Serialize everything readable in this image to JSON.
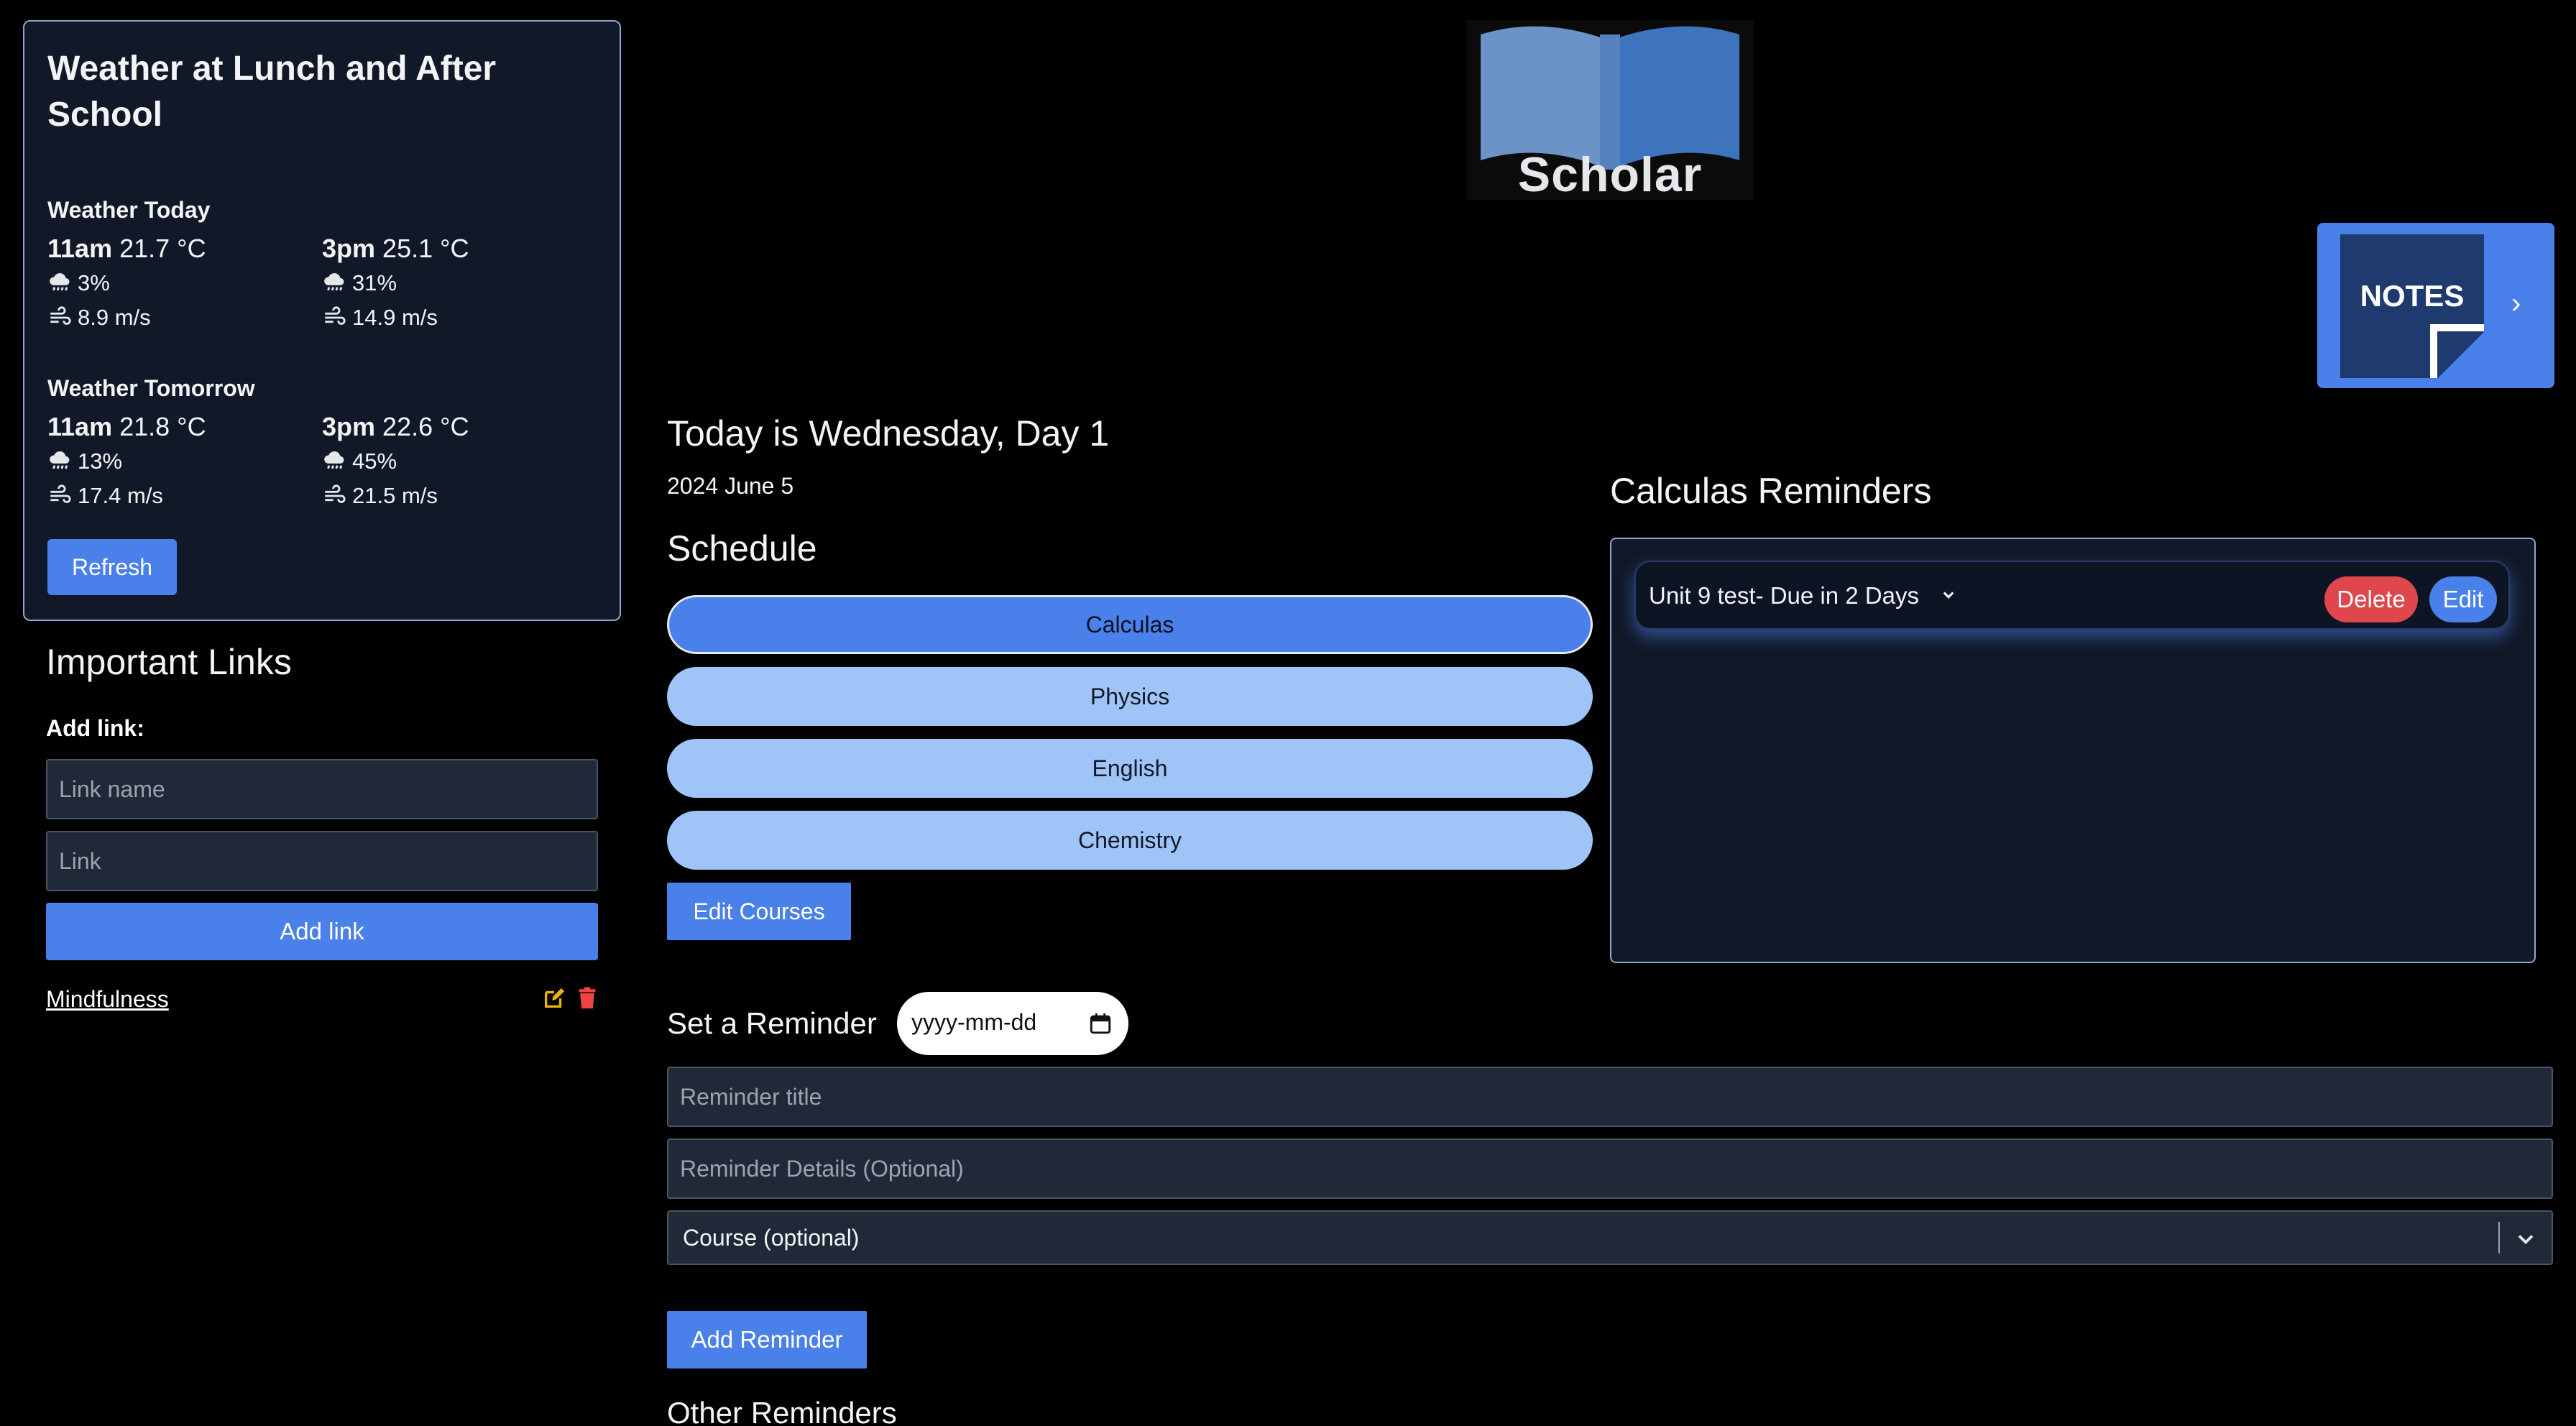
{
  "weather": {
    "title": "Weather at Lunch and After School",
    "today": {
      "label": "Weather Today",
      "slots": [
        {
          "time": "11am",
          "temp": "21.7 °C",
          "precip": "3%",
          "wind": "8.9 m/s"
        },
        {
          "time": "3pm",
          "temp": "25.1 °C",
          "precip": "31%",
          "wind": "14.9 m/s"
        }
      ]
    },
    "tomorrow": {
      "label": "Weather Tomorrow",
      "slots": [
        {
          "time": "11am",
          "temp": "21.8 °C",
          "precip": "13%",
          "wind": "17.4 m/s"
        },
        {
          "time": "3pm",
          "temp": "22.6 °C",
          "precip": "45%",
          "wind": "21.5 m/s"
        }
      ]
    },
    "refresh_label": "Refresh",
    "icons": {
      "precip": "rain-cloud-icon",
      "wind": "wind-icon"
    }
  },
  "links": {
    "title": "Important Links",
    "add_label": "Add link:",
    "name_placeholder": "Link name",
    "url_placeholder": "Link",
    "add_button": "Add link",
    "items": [
      {
        "name": "Mindfulness",
        "edit_icon": "edit-icon",
        "delete_icon": "trash-icon"
      }
    ]
  },
  "logo": {
    "text": "Scholar"
  },
  "notes": {
    "label": "NOTES",
    "chevron": "›"
  },
  "today": {
    "line": "Today is Wednesday, Day 1",
    "date": "2024 June 5"
  },
  "schedule": {
    "title": "Schedule",
    "courses": [
      {
        "name": "Calculas",
        "active": true
      },
      {
        "name": "Physics",
        "active": false
      },
      {
        "name": "English",
        "active": false
      },
      {
        "name": "Chemistry",
        "active": false
      }
    ],
    "edit_button": "Edit Courses"
  },
  "reminders": {
    "title": "Calculas Reminders",
    "items": [
      {
        "text": "Unit 9 test- Due in 2 Days",
        "delete_label": "Delete",
        "edit_label": "Edit"
      }
    ]
  },
  "form": {
    "set_label": "Set a Reminder",
    "date_placeholder": "yyyy-mm-dd",
    "title_placeholder": "Reminder title",
    "details_placeholder": "Reminder Details (Optional)",
    "course_select_value": "Course (optional)",
    "add_button": "Add Reminder",
    "other_title": "Other Reminders"
  },
  "colors": {
    "accent": "#4a80ea",
    "course_inactive": "#9fc5f8",
    "danger": "#e0474c",
    "panel_bg": "#111827",
    "panel_border": "#8ea6cf"
  }
}
